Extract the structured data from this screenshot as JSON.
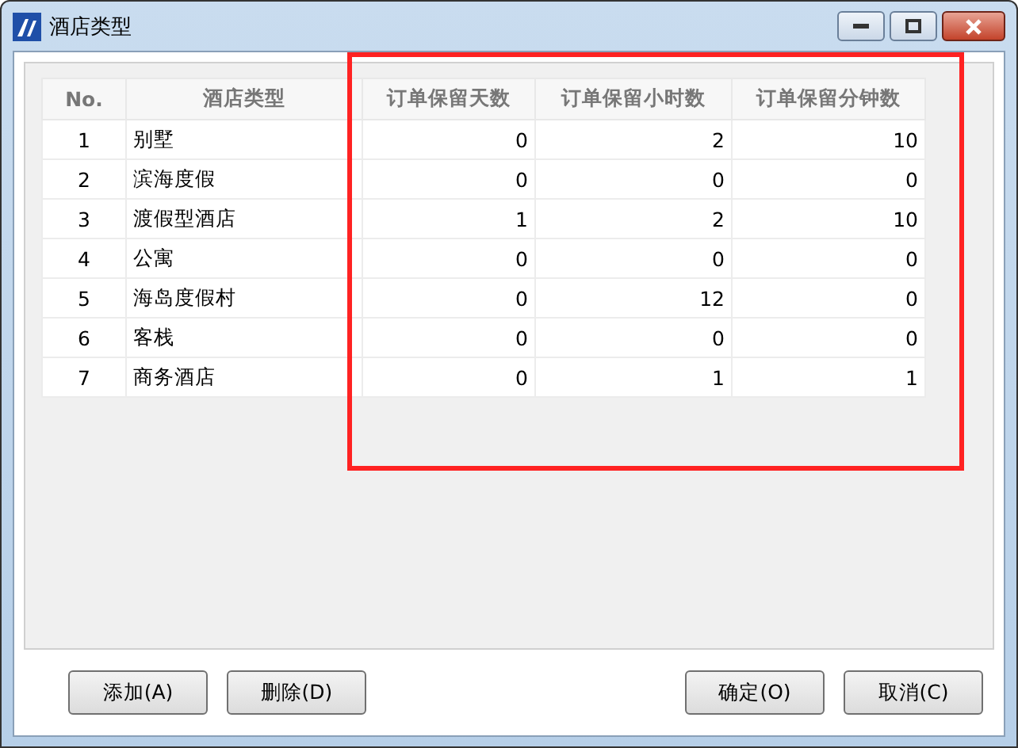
{
  "window": {
    "title": "酒店类型"
  },
  "table": {
    "columns": [
      "No.",
      "酒店类型",
      "订单保留天数",
      "订单保留小时数",
      "订单保留分钟数"
    ],
    "rows": [
      [
        "1",
        "别墅",
        "0",
        "2",
        "10"
      ],
      [
        "2",
        "滨海度假",
        "0",
        "0",
        "0"
      ],
      [
        "3",
        "渡假型酒店",
        "1",
        "2",
        "10"
      ],
      [
        "4",
        "公寓",
        "0",
        "0",
        "0"
      ],
      [
        "5",
        "海岛度假村",
        "0",
        "12",
        "0"
      ],
      [
        "6",
        "客栈",
        "0",
        "0",
        "0"
      ],
      [
        "7",
        "商务酒店",
        "0",
        "1",
        "1"
      ]
    ]
  },
  "left_buttons": [
    "添加(A)",
    "删除(D)"
  ],
  "right_buttons": [
    "确定(O)",
    "取消(C)"
  ]
}
